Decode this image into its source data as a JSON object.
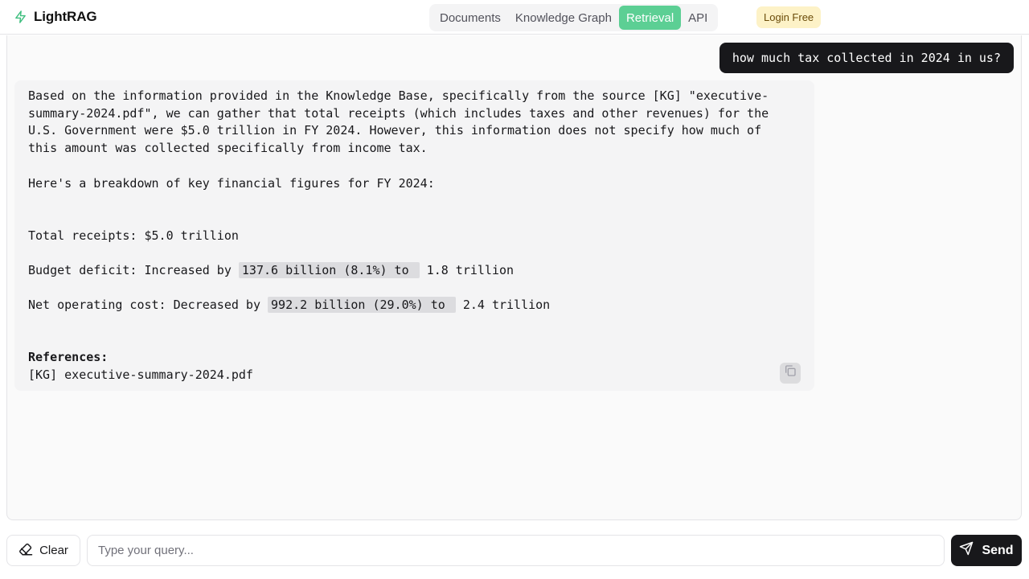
{
  "app": {
    "name": "LightRAG",
    "accent_color": "#5ccf94"
  },
  "nav": {
    "tabs": [
      {
        "label": "Documents",
        "active": false
      },
      {
        "label": "Knowledge Graph",
        "active": false
      },
      {
        "label": "Retrieval",
        "active": true
      },
      {
        "label": "API",
        "active": false
      }
    ],
    "login_label": "Login Free"
  },
  "chat": {
    "user_message": "how much tax collected in 2024 in us?",
    "assistant": {
      "intro_lines": [
        "Based on the information provided in the Knowledge Base, specifically from the source [KG] \"executive-",
        "summary-2024.pdf\", we can gather that total receipts (which includes taxes and other revenues) for the",
        "U.S. Government were $5.0 trillion in FY 2024. However, this information does not specify how much of",
        "this amount was collected specifically from income tax."
      ],
      "breakdown_intro": "Here's a breakdown of key financial figures for FY 2024:",
      "total_receipts": "Total receipts: $5.0 trillion",
      "deficit": {
        "prefix": "Budget deficit: Increased by ",
        "highlight": "137.6 billion (8.1%) to ",
        "suffix": " 1.8 trillion"
      },
      "net_cost": {
        "prefix": "Net operating cost: Decreased by ",
        "highlight": "992.2 billion (29.0%) to ",
        "suffix": " 2.4 trillion"
      },
      "references_heading": "References:",
      "reference_item": "[KG] executive-summary-2024.pdf",
      "copy_icon": "copy-icon"
    }
  },
  "input_bar": {
    "clear_label": "Clear",
    "clear_icon": "eraser-icon",
    "placeholder": "Type your query...",
    "value": "",
    "send_label": "Send",
    "send_icon": "send-icon"
  }
}
